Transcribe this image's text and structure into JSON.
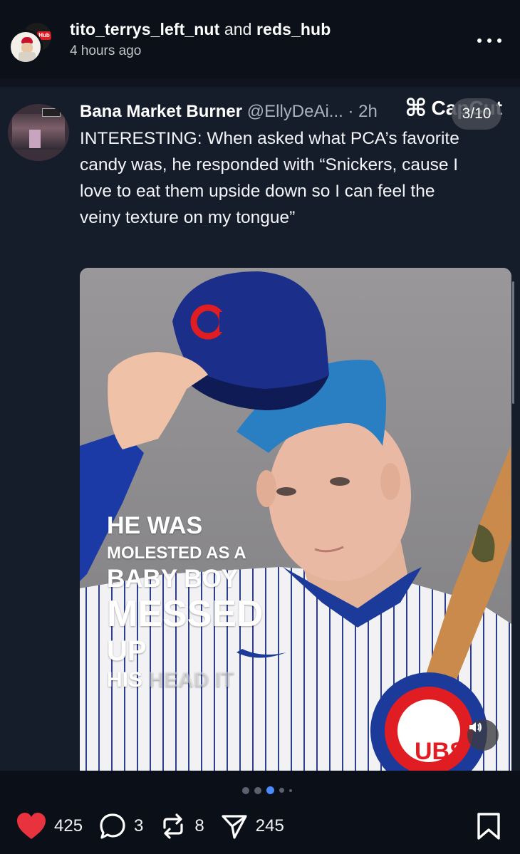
{
  "header": {
    "user1": "tito_terrys_left_nut",
    "joiner": "and",
    "user2": "reds_hub",
    "time": "4 hours ago",
    "hub_badge": "Hub"
  },
  "tweet": {
    "name": "Bana Market Burner",
    "handle": "@EllyDeAi... · 2h",
    "body": "INTERESTING: When asked what PCA’s favorite candy was, he responded with “Snickers, cause I love to eat them upside down so I can feel the veiny texture on my tongue”"
  },
  "watermark": {
    "capcut": "CapCut"
  },
  "carousel": {
    "counter": "3/10",
    "active_index": 2,
    "total_dots": 5
  },
  "image_caption": {
    "line1": "HE WAS",
    "line2": "MOLESTED AS A",
    "line3": "BABY BOY",
    "line4": "MESSED",
    "line5": "UP",
    "line6a": "HIS",
    "line6b": " HEAD IT"
  },
  "stats": {
    "likes": "425",
    "comments": "3",
    "reposts": "8",
    "shares": "245"
  },
  "colors": {
    "like": "#e8333f",
    "active_dot": "#4a8cff",
    "card_bg": "#151c2a"
  },
  "icons": [
    "heart-icon",
    "comment-icon",
    "repost-icon",
    "share-icon",
    "bookmark-icon",
    "more-icon",
    "sound-icon"
  ]
}
